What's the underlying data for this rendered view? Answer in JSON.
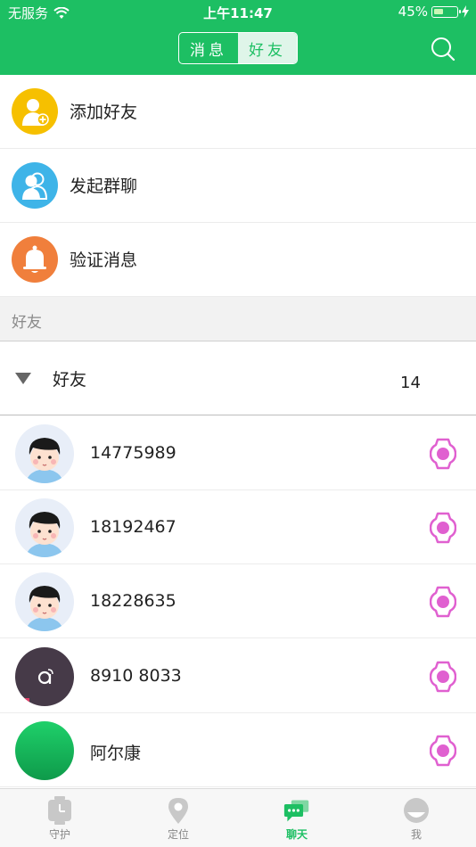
{
  "status_bar": {
    "carrier": "无服务",
    "time": "上午11:47",
    "battery": "45%",
    "battery_level": 0.45
  },
  "nav": {
    "tab_messages": "消息",
    "tab_friends": "好友",
    "active_tab": "好友"
  },
  "menu": [
    {
      "label": "添加好友",
      "icon": "add-friend-icon",
      "color": "#f6c000"
    },
    {
      "label": "发起群聊",
      "icon": "group-chat-icon",
      "color": "#3eb4e8"
    },
    {
      "label": "验证消息",
      "icon": "bell-icon",
      "color": "#f07f3c"
    }
  ],
  "section": {
    "title": "好友"
  },
  "group": {
    "label": "好友",
    "count": "14"
  },
  "friends": [
    {
      "name": "14775989",
      "avatar": "cartoon-boy-avatar"
    },
    {
      "name": "18192467",
      "avatar": "cartoon-boy-avatar"
    },
    {
      "name": "18228635",
      "avatar": "cartoon-boy-avatar"
    },
    {
      "name": "8910 8033",
      "avatar": "dark-logo-avatar"
    },
    {
      "name": "阿尔康",
      "avatar": "green-avatar"
    }
  ],
  "colors": {
    "brand": "#1dbf63",
    "watch": "#e060d0"
  },
  "tabbar": [
    {
      "label": "守护",
      "icon": "clock-watch-icon"
    },
    {
      "label": "定位",
      "icon": "location-pin-icon"
    },
    {
      "label": "聊天",
      "icon": "chat-bubble-icon",
      "active": true
    },
    {
      "label": "我",
      "icon": "profile-face-icon"
    }
  ]
}
